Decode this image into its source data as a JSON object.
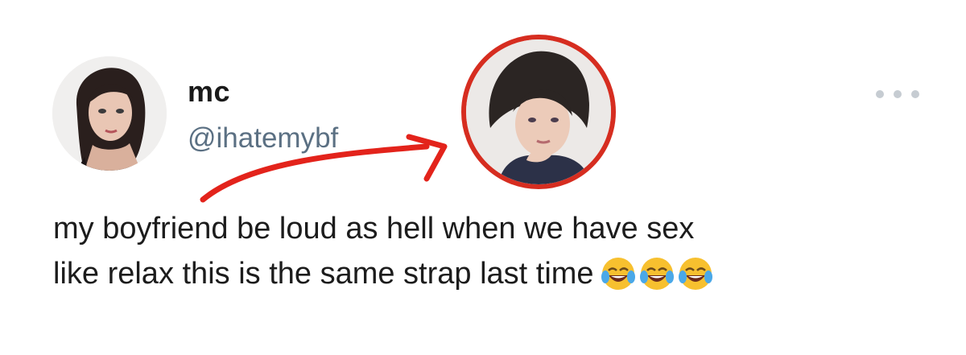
{
  "tweet": {
    "author": {
      "display_name": "mc",
      "handle": "@ihatemybf",
      "avatar_icon": "woman-portrait-avatar"
    },
    "more_icon": "more-dots-icon",
    "text_lines": [
      "my boyfriend be loud as hell when we have sex",
      "like relax this is the same strap last time"
    ],
    "emojis": [
      "face-with-tears-of-joy-icon",
      "face-with-tears-of-joy-icon",
      "face-with-tears-of-joy-icon"
    ]
  },
  "annotation": {
    "highlight_icon": "man-portrait-avatar",
    "ring_color": "#d62d20",
    "arrow_color": "#e3231b"
  },
  "colors": {
    "handle": "#5b7083",
    "text": "#1c1c1c",
    "dots": "#c6ccd2"
  }
}
